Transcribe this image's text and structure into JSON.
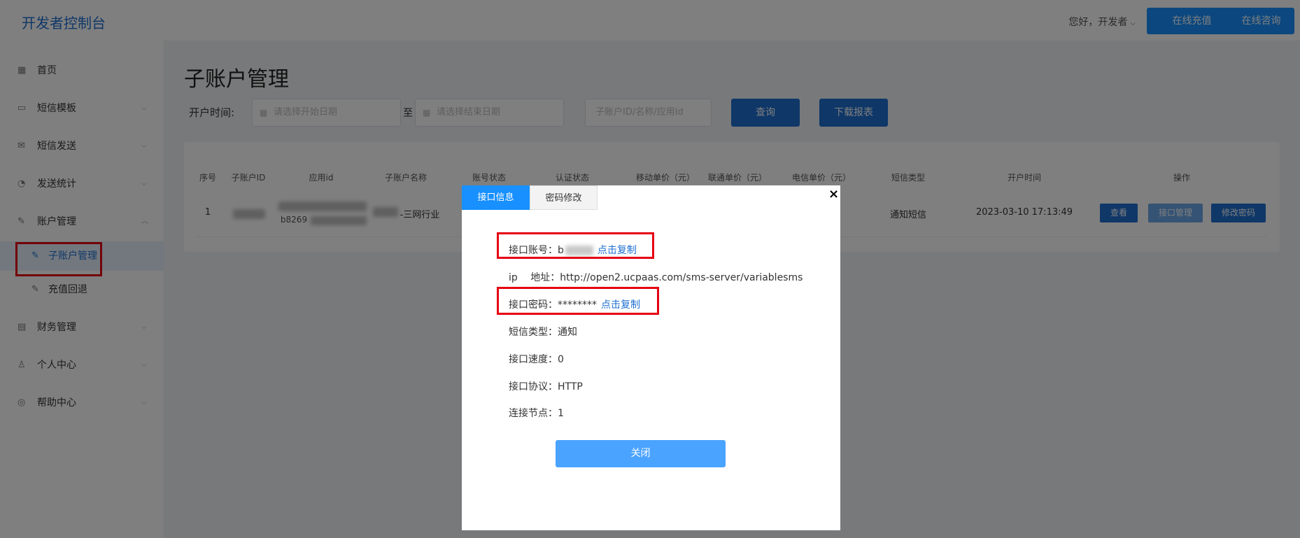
{
  "header": {
    "logo": "开发者控制台",
    "greeting": "您好，开发者",
    "recharge_label": "在线充值",
    "consult_label": "在线咨询"
  },
  "sidebar": {
    "items": [
      {
        "label": "首页",
        "icon": "grid-icon"
      },
      {
        "label": "短信模板",
        "icon": "template-icon"
      },
      {
        "label": "短信发送",
        "icon": "mail-icon"
      },
      {
        "label": "发送统计",
        "icon": "pie-chart-icon"
      },
      {
        "label": "账户管理",
        "icon": "edit-icon"
      },
      {
        "label": "子账户管理",
        "icon": "edit-icon"
      },
      {
        "label": "充值回退",
        "icon": "edit-icon"
      },
      {
        "label": "财务管理",
        "icon": "folder-icon"
      },
      {
        "label": "个人中心",
        "icon": "user-icon"
      },
      {
        "label": "帮助中心",
        "icon": "help-icon"
      }
    ]
  },
  "main": {
    "title": "子账户管理",
    "filter_label": "开户时间:",
    "start_placeholder": "请选择开始日期",
    "to_label": "至",
    "end_placeholder": "请选择结束日期",
    "search_placeholder": "子账户ID/名称/应用Id",
    "query_label": "查询",
    "download_label": "下载报表"
  },
  "table": {
    "headers": [
      "序号",
      "子账户ID",
      "应用id",
      "子账户名称",
      "账号状态",
      "认证状态",
      "移动单价（元）",
      "联通单价（元）",
      "电信单价（元）",
      "短信类型",
      "开户时间",
      "操作"
    ],
    "row": {
      "index": "1",
      "app_id_partial": "b8269",
      "name_partial": "-三网行业",
      "sms_type": "通知短信",
      "open_time": "2023-03-10 17:13:49",
      "actions": [
        "查看",
        "接口管理",
        "修改密码"
      ]
    }
  },
  "modal": {
    "tabs": [
      "接口信息",
      "密码修改"
    ],
    "close_icon": "×",
    "account_label": "接口账号：",
    "account_partial": "b",
    "copy_label": "点击复制",
    "ip_label": "ip　 地址：",
    "ip_value": "http://open2.ucpaas.com/sms-server/variablesms",
    "password_label": "接口密码：",
    "password_value": "********",
    "sms_type_label": "短信类型：",
    "sms_type_value": "通知",
    "speed_label": "接口速度：",
    "speed_value": "0",
    "protocol_label": "接口协议：",
    "protocol_value": "HTTP",
    "node_label": "连接节点：",
    "node_value": "1",
    "close_button": "关闭"
  }
}
